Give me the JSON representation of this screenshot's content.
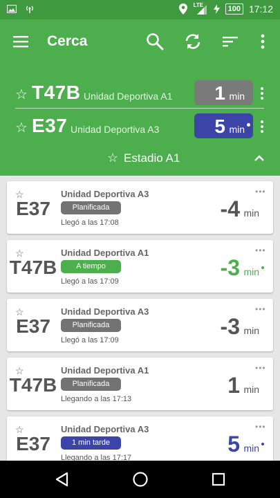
{
  "status_bar": {
    "lte": "LTE",
    "battery": "100",
    "time": "17:12"
  },
  "app_bar": {
    "title": "Cerca"
  },
  "favorites": [
    {
      "route": "T47B",
      "destination": "Unidad Deportiva A1",
      "minutes": "1",
      "unit": "min",
      "color": "#7a7a7a",
      "live": false
    },
    {
      "route": "E37",
      "destination": "Unidad Deportiva A3",
      "minutes": "5",
      "unit": "min",
      "color": "#3d44a8",
      "live": true
    }
  ],
  "stop": {
    "name": "Estadio A1"
  },
  "arrivals": [
    {
      "route": "E37",
      "destination": "Unidad Deportiva A3",
      "badge": "Planificada",
      "badge_color": "#737373",
      "status": "Llegó a las 17:08",
      "minutes": "-4",
      "unit": "min",
      "color": "#555555",
      "live": false
    },
    {
      "route": "T47B",
      "destination": "Unidad Deportiva A1",
      "badge": "A tiempo",
      "badge_color": "#4cae4c",
      "status": "Llegó a las 17:09",
      "minutes": "-3",
      "unit": "min",
      "color": "#4cae4c",
      "live": true
    },
    {
      "route": "E37",
      "destination": "Unidad Deportiva A3",
      "badge": "Planificada",
      "badge_color": "#737373",
      "status": "Llegó a las 17:09",
      "minutes": "-3",
      "unit": "min",
      "color": "#555555",
      "live": false
    },
    {
      "route": "T47B",
      "destination": "Unidad Deportiva A1",
      "badge": "Planificada",
      "badge_color": "#737373",
      "status": "Llegando a las 17:13",
      "minutes": "1",
      "unit": "min",
      "color": "#555555",
      "live": false
    },
    {
      "route": "E37",
      "destination": "Unidad Deportiva A3",
      "badge": "1 min tarde",
      "badge_color": "#3d44a8",
      "status": "Llegando a las 17:17",
      "minutes": "5",
      "unit": "min",
      "color": "#3d44a8",
      "live": true
    }
  ],
  "icons": {
    "menu": "menu-icon",
    "search": "search-icon",
    "refresh": "refresh-icon",
    "sort": "sort-icon",
    "more": "more-vert-icon"
  },
  "colors": {
    "primary": "#4cae4c",
    "status_bar": "#3f9a3f",
    "late": "#3d44a8",
    "scheduled": "#737373"
  }
}
